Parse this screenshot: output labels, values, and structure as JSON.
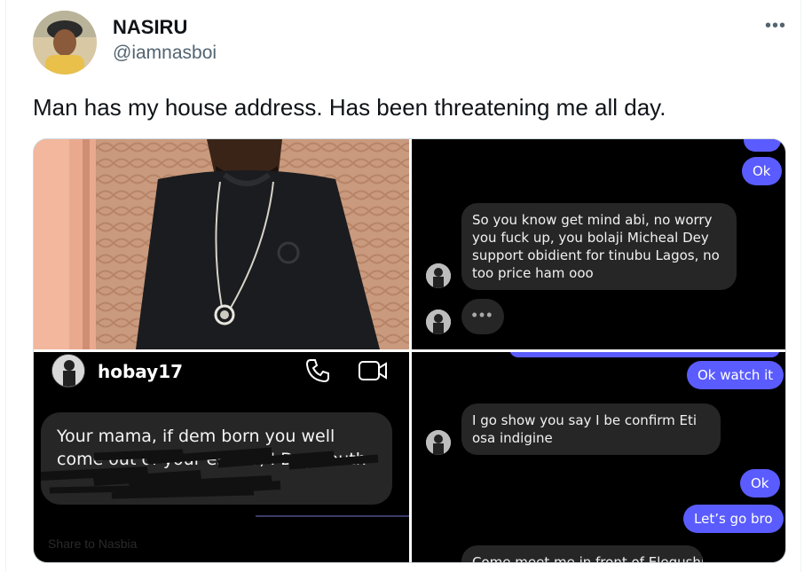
{
  "tweet": {
    "author_name": "NASIRU",
    "author_handle": "@iamnasboi",
    "text": "Man has my house address. Has been threatening me all day.",
    "more_icon": "more-icon"
  },
  "media": {
    "chat1": {
      "out_top": "Ok",
      "in_message": "So you know get mind abi, no worry you fuck up, you bolaji Micheal Dey support obidient for tinubu Lagos, no too price ham ooo",
      "typing": "•••"
    },
    "chat2": {
      "username": "hobay17",
      "message": "Your mama, if dem born you well come out of your estate, I Dey south",
      "footer": "Share to Nasbia"
    },
    "chat3": {
      "out_1": "Ok watch it",
      "in_message": "I go show you say I be confirm Eti osa indigine",
      "out_2": "Ok",
      "out_3": "Let’s go bro",
      "in_partial": "Come meet me in front of Elegushi"
    }
  },
  "colors": {
    "accent": "#5a5cff",
    "text_primary": "#0f1419",
    "text_secondary": "#536471"
  }
}
